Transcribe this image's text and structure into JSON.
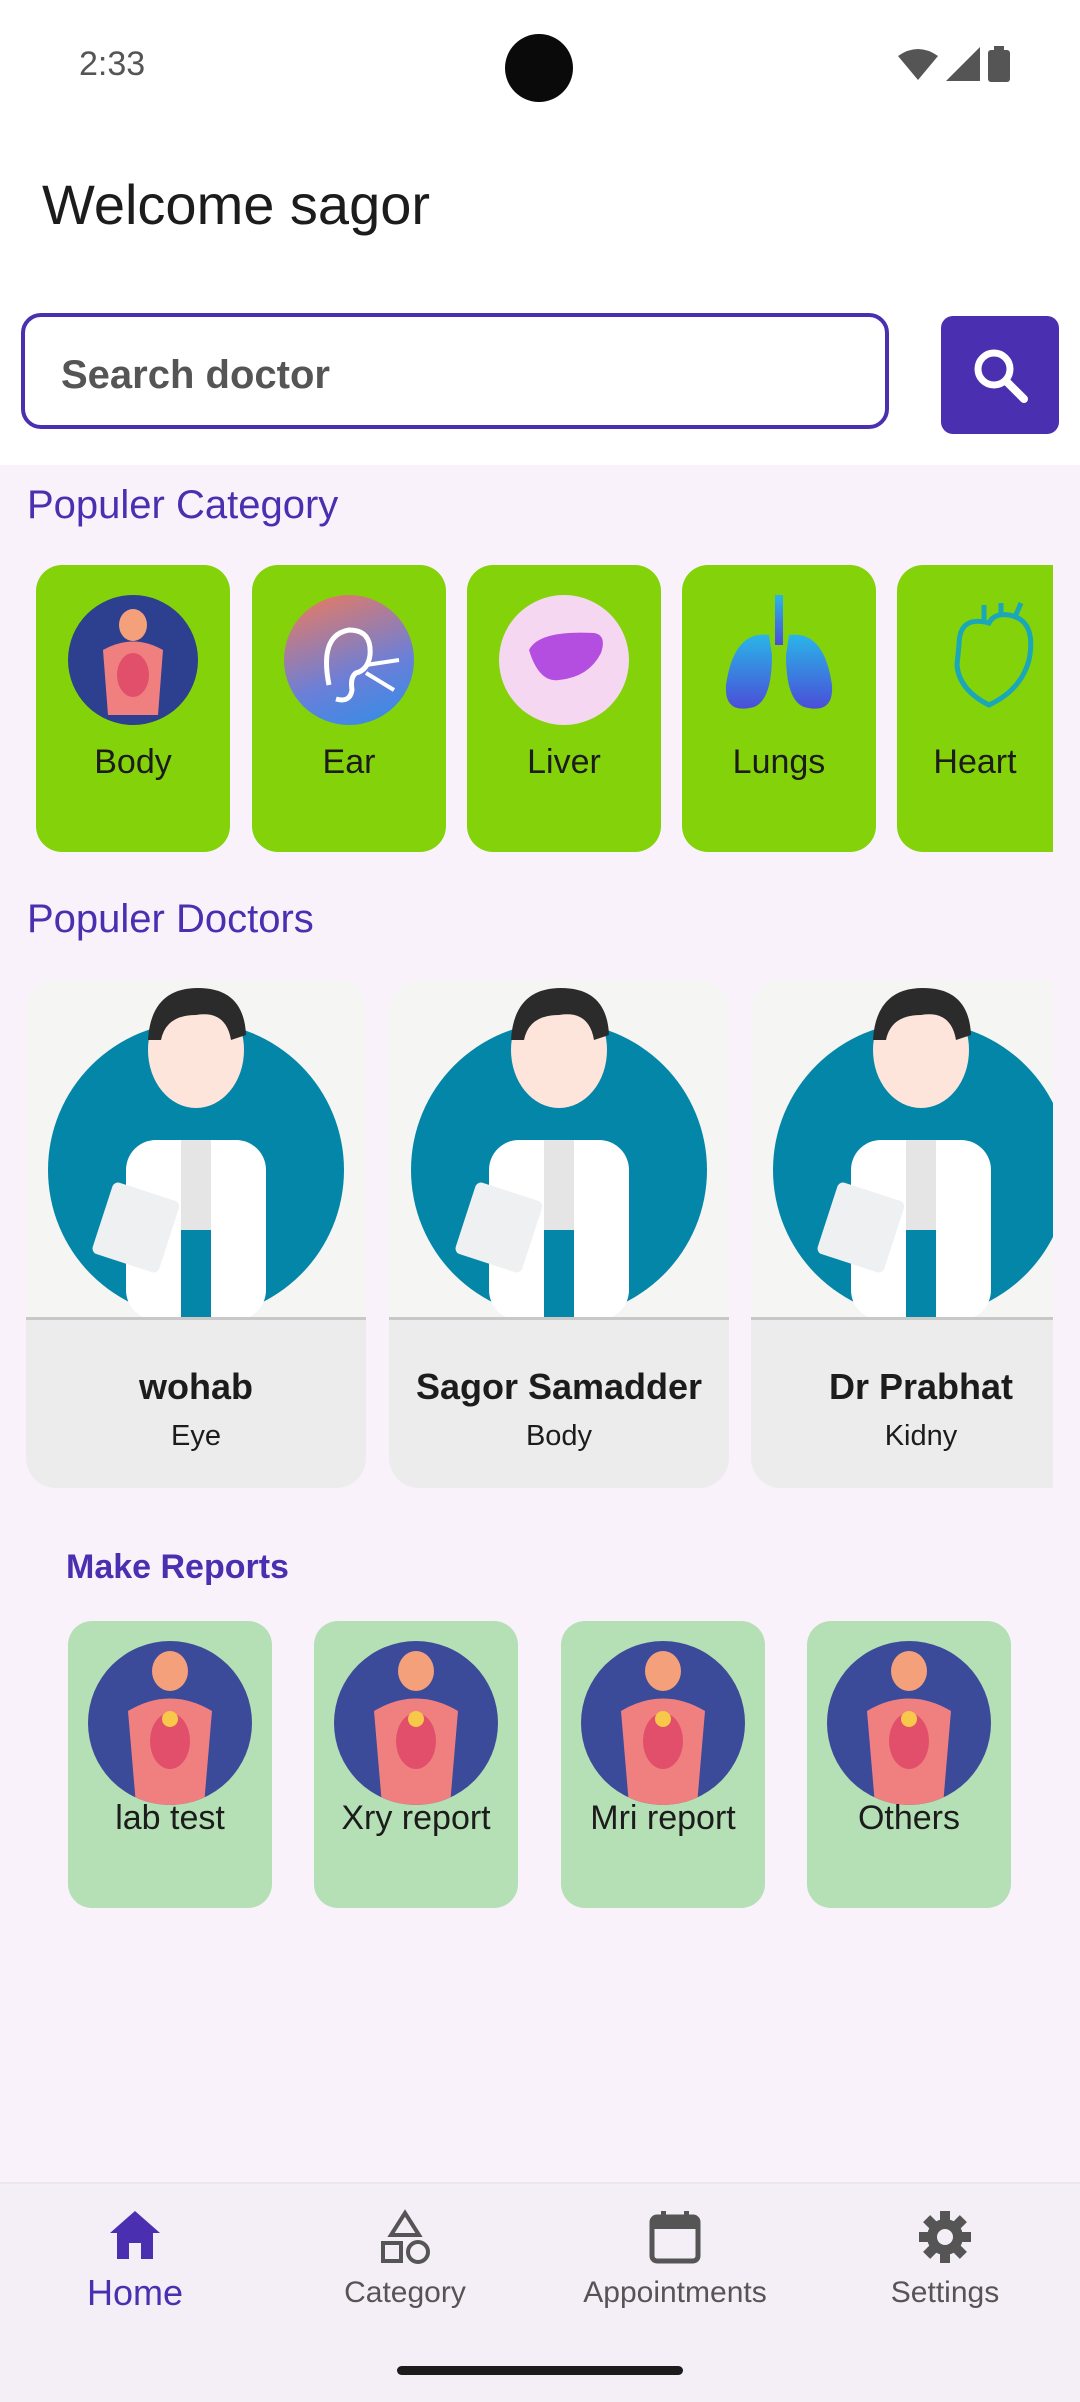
{
  "status_bar": {
    "time": "2:33"
  },
  "header": {
    "welcome": "Welcome  sagor"
  },
  "search": {
    "placeholder": "Search doctor"
  },
  "categories": {
    "title": "Populer Category",
    "items": [
      {
        "label": "Body",
        "icon": "body-icon"
      },
      {
        "label": "Ear",
        "icon": "ear-icon"
      },
      {
        "label": "Liver",
        "icon": "liver-icon"
      },
      {
        "label": "Lungs",
        "icon": "lungs-icon"
      },
      {
        "label": "Heart",
        "icon": "heart-icon"
      }
    ]
  },
  "doctors": {
    "title": "Populer Doctors",
    "items": [
      {
        "name": "wohab",
        "specialty": "Eye"
      },
      {
        "name": "Sagor Samadder",
        "specialty": "Body"
      },
      {
        "name": "Dr Prabhat",
        "specialty": "Kidny"
      }
    ]
  },
  "reports": {
    "title": "Make Reports",
    "items": [
      {
        "label": "lab test"
      },
      {
        "label": "Xry report"
      },
      {
        "label": "Mri report"
      },
      {
        "label": "Others"
      }
    ]
  },
  "nav": {
    "items": [
      {
        "label": "Home",
        "icon": "home-icon",
        "active": true
      },
      {
        "label": "Category",
        "icon": "category-icon"
      },
      {
        "label": "Appointments",
        "icon": "calendar-icon"
      },
      {
        "label": "Settings",
        "icon": "gear-icon"
      }
    ]
  },
  "colors": {
    "primary": "#4a2fb0",
    "category_bg": "#84d20a",
    "report_bg": "#b5dfb5",
    "content_bg": "#f9f2fb"
  }
}
